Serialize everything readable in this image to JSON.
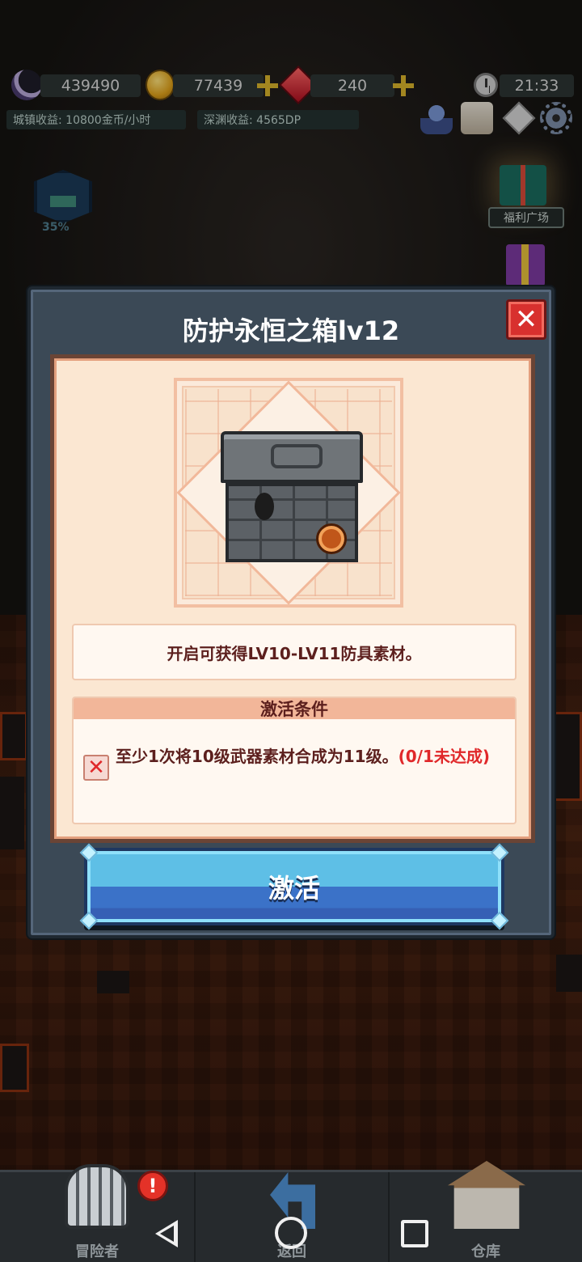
{
  "hud": {
    "souls": "439490",
    "gold": "77439",
    "gems": "240",
    "time": "21:33",
    "town_income": "城镇收益: 10800金币/小时",
    "abyss_income": "深渊收益: 4565DP",
    "progress_pct": "35%",
    "welfare_label": "福利广场"
  },
  "modal": {
    "title": "防护永恒之箱lv12",
    "close_label": "✕",
    "description": "开启可获得LV10-LV11防具素材。",
    "condition_header": "激活条件",
    "conditions": [
      {
        "met": false,
        "check_mark": "✕",
        "text": "至少1次将10级武器素材合成为11级。",
        "status": "(0/1未达成)"
      }
    ],
    "activate_label": "激活"
  },
  "bottom_tabs": {
    "adventurer": "冒险者",
    "adventurer_alert": "!",
    "back": "返回",
    "warehouse": "仓库"
  },
  "colors": {
    "modal_bg": "#3b4956",
    "panel_bg": "#fbe7d2",
    "text_dark_red": "#5c1f1d",
    "status_red": "#e0282a",
    "button_blue": "#5ebfe6"
  }
}
